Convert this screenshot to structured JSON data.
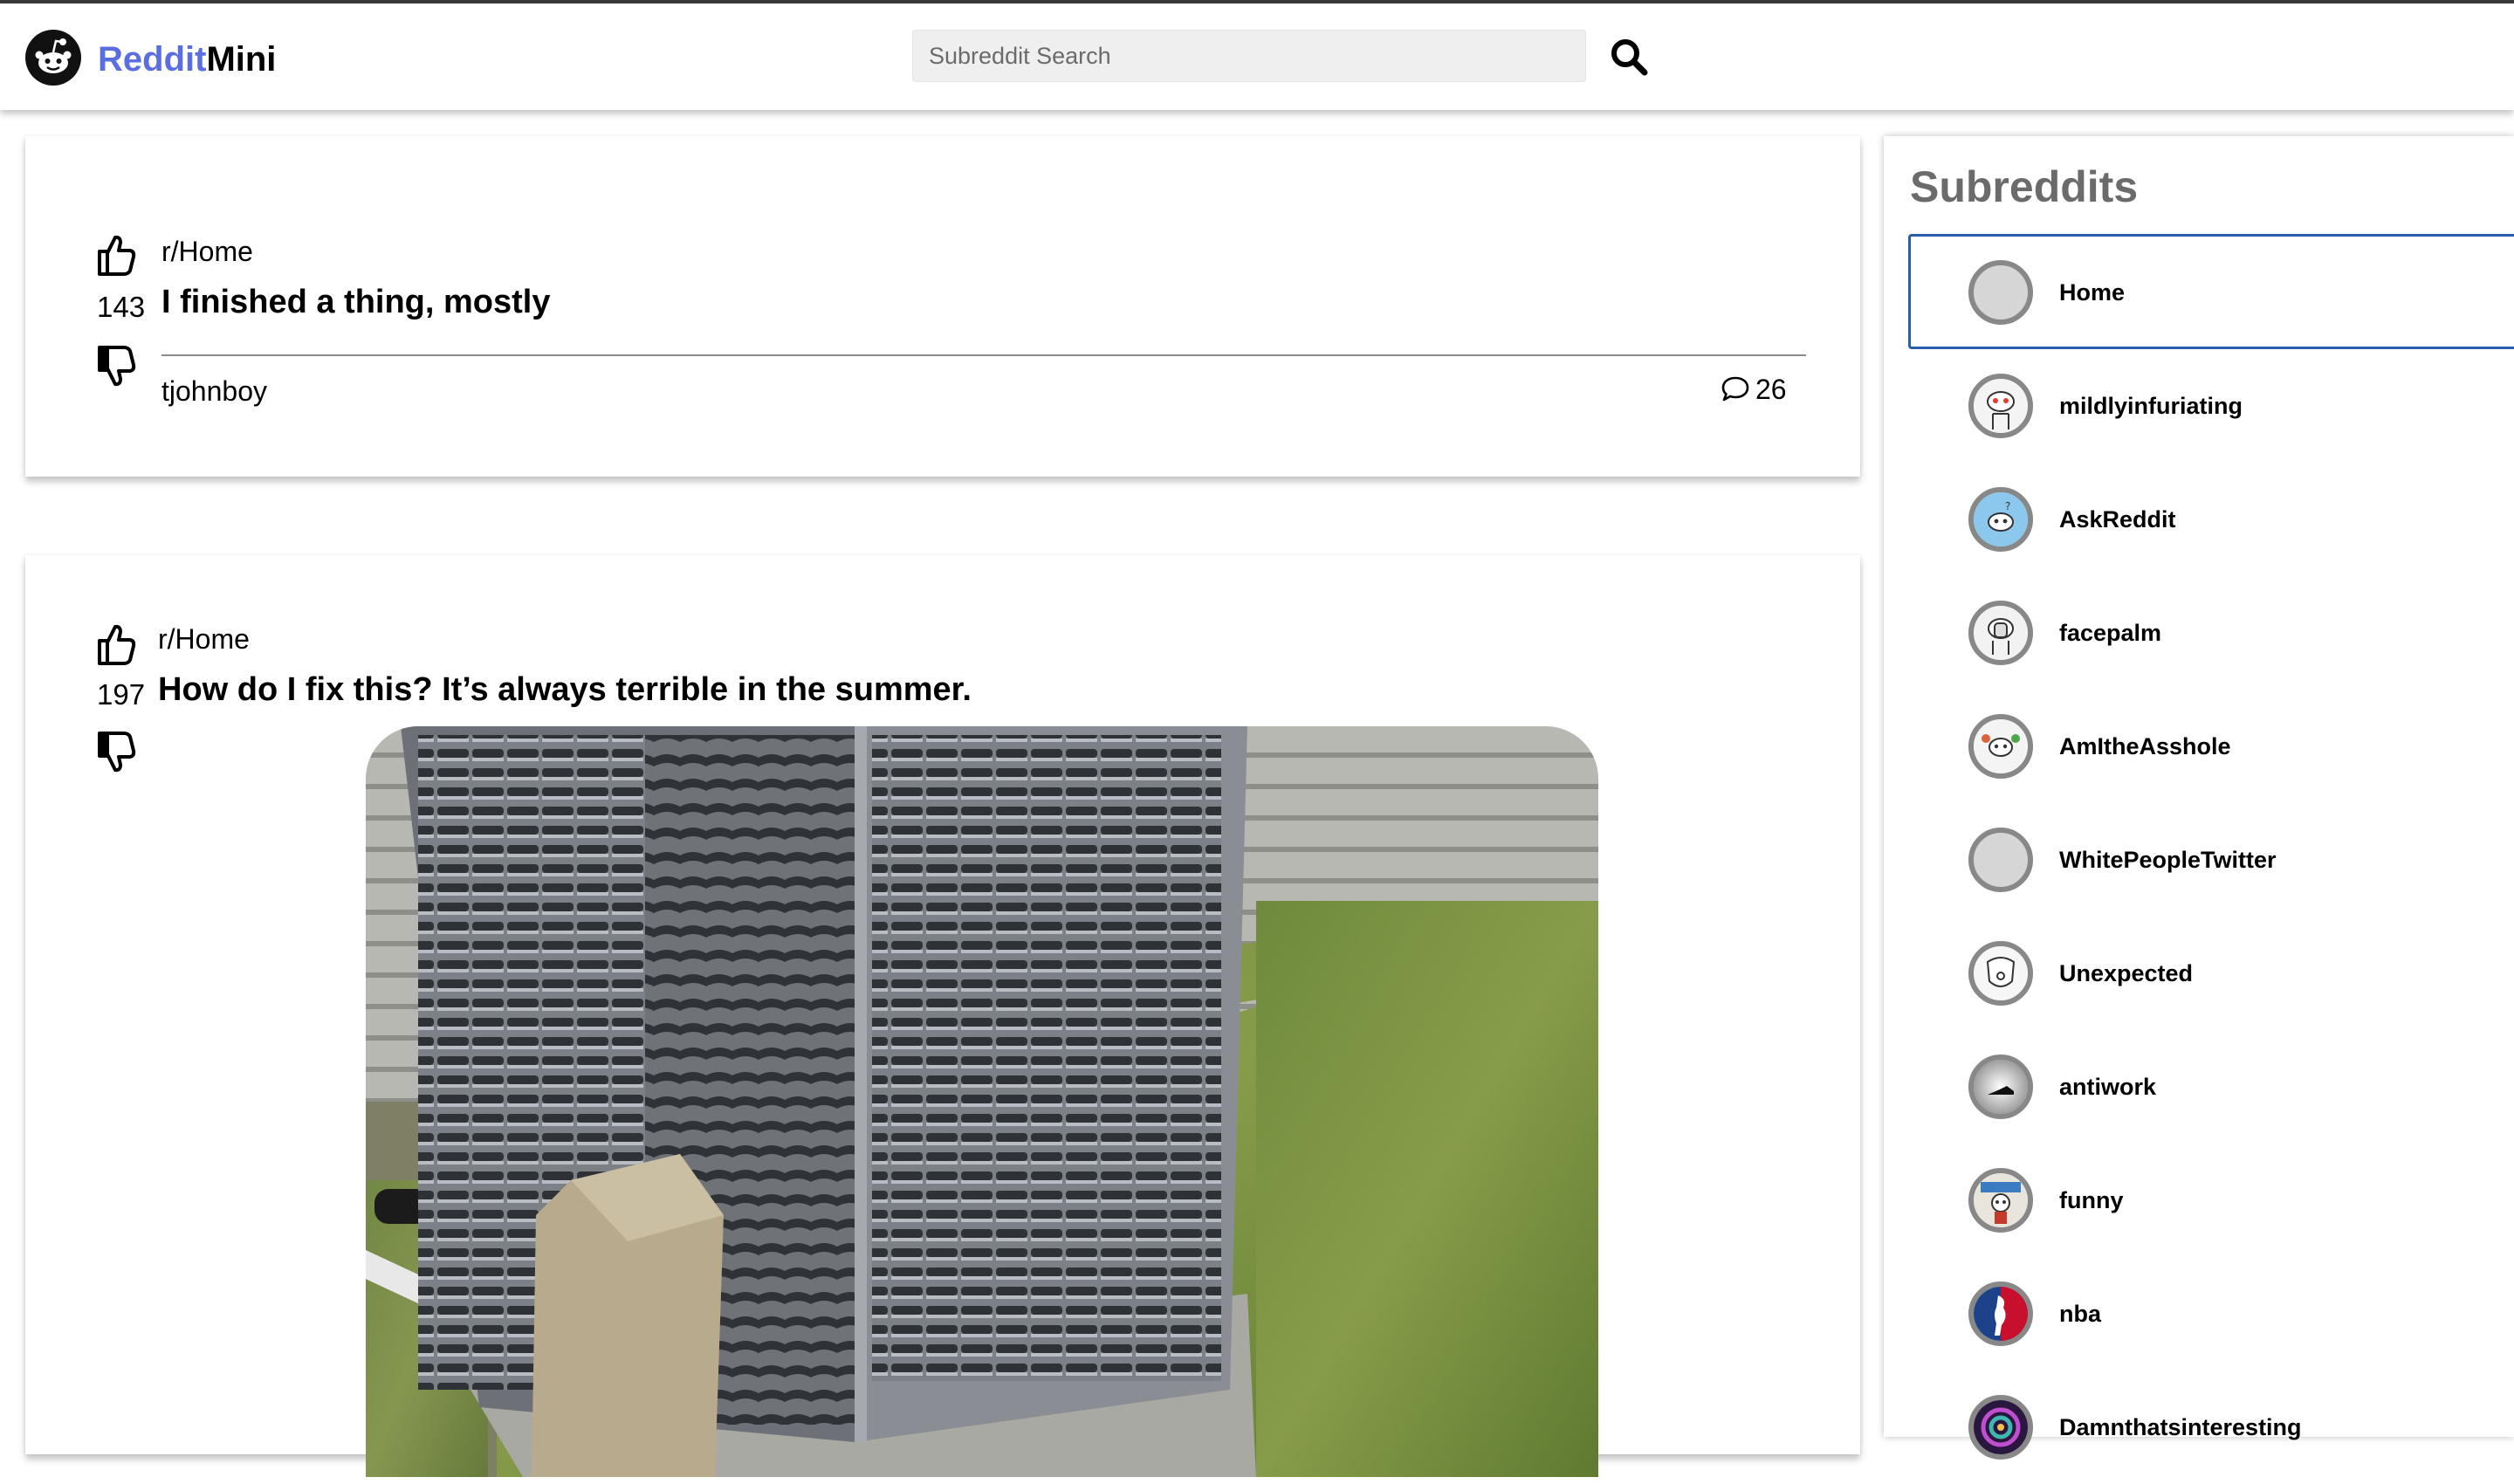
{
  "app": {
    "brand_accent": "Reddit",
    "brand_rest": "Mini",
    "accent_color": "#5b6ee1"
  },
  "search": {
    "placeholder": "Subreddit Search",
    "value": "",
    "button_icon": "search-icon"
  },
  "posts": [
    {
      "subreddit": "r/Home",
      "score": "143",
      "title": "I finished a thing, mostly",
      "author": "tjohnboy",
      "comments": "26",
      "upvote_icon": "thumbs-up-icon",
      "downvote_icon": "thumbs-down-icon",
      "comment_icon": "comment-bubble-icon"
    },
    {
      "subreddit": "r/Home",
      "score": "197",
      "title": "How do I fix this? It’s always terrible in the summer.",
      "image": "photo of outdoor air conditioner unit on grass",
      "upvote_icon": "thumbs-up-icon",
      "downvote_icon": "thumbs-down-icon"
    }
  ],
  "sidebar": {
    "title": "Subreddits",
    "items": [
      {
        "label": "Home",
        "active": true
      },
      {
        "label": "mildlyinfuriating"
      },
      {
        "label": "AskReddit"
      },
      {
        "label": "facepalm"
      },
      {
        "label": "AmItheAsshole"
      },
      {
        "label": "WhitePeopleTwitter"
      },
      {
        "label": "Unexpected"
      },
      {
        "label": "antiwork"
      },
      {
        "label": "funny"
      },
      {
        "label": "nba"
      },
      {
        "label": "Damnthatsinteresting"
      }
    ],
    "active_border_color": "#2a5db0"
  }
}
